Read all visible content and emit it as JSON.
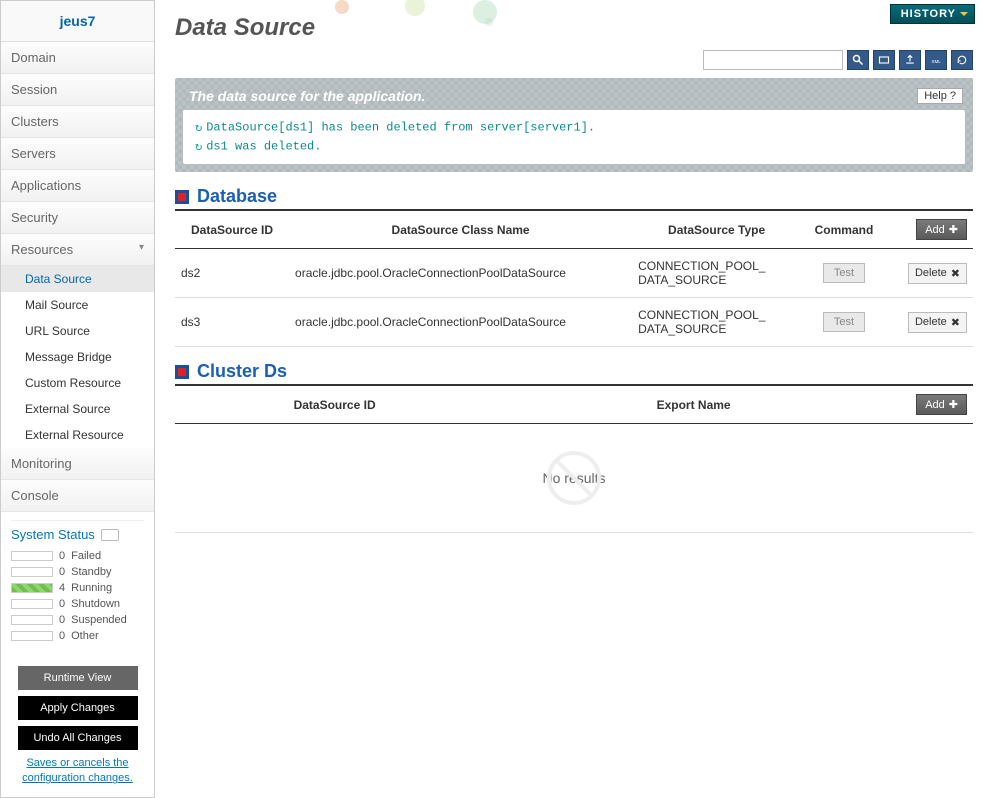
{
  "brand": "jeus7",
  "nav": {
    "items": [
      "Domain",
      "Session",
      "Clusters",
      "Servers",
      "Applications",
      "Security",
      "Resources",
      "Monitoring",
      "Console"
    ],
    "resources_sub": [
      "Data Source",
      "Mail Source",
      "URL Source",
      "Message Bridge",
      "Custom Resource",
      "External Source",
      "External Resource"
    ],
    "active_sub": "Data Source"
  },
  "system_status": {
    "title": "System Status",
    "rows": [
      {
        "count": "0",
        "label": "Failed",
        "cls": ""
      },
      {
        "count": "0",
        "label": "Standby",
        "cls": ""
      },
      {
        "count": "4",
        "label": "Running",
        "cls": "running"
      },
      {
        "count": "0",
        "label": "Shutdown",
        "cls": ""
      },
      {
        "count": "0",
        "label": "Suspended",
        "cls": ""
      },
      {
        "count": "0",
        "label": "Other",
        "cls": ""
      }
    ]
  },
  "buttons": {
    "runtime_view": "Runtime View",
    "apply_changes": "Apply Changes",
    "undo_all": "Undo All Changes",
    "save_hint": "Saves or cancels the configuration changes."
  },
  "top": {
    "history": "HISTORY",
    "help": "Help ?"
  },
  "page_title": "Data Source",
  "search": {
    "placeholder": ""
  },
  "notice": {
    "header": "The data source for the application.",
    "lines": [
      "DataSource[ds1] has been deleted from server[server1].",
      "ds1 was deleted."
    ]
  },
  "database": {
    "title": "Database",
    "headers": [
      "DataSource ID",
      "DataSource Class Name",
      "DataSource Type",
      "Command",
      ""
    ],
    "add_label": "Add",
    "test_label": "Test",
    "delete_label": "Delete",
    "rows": [
      {
        "id": "ds2",
        "cls": "oracle.jdbc.pool.OracleConnectionPoolDataSource",
        "type": "CONNECTION_POOL_DATA_SOURCE"
      },
      {
        "id": "ds3",
        "cls": "oracle.jdbc.pool.OracleConnectionPoolDataSource",
        "type": "CONNECTION_POOL_DATA_SOURCE"
      }
    ]
  },
  "clusterds": {
    "title": "Cluster Ds",
    "headers": [
      "DataSource ID",
      "Export Name",
      ""
    ],
    "add_label": "Add",
    "no_results": "No results"
  }
}
